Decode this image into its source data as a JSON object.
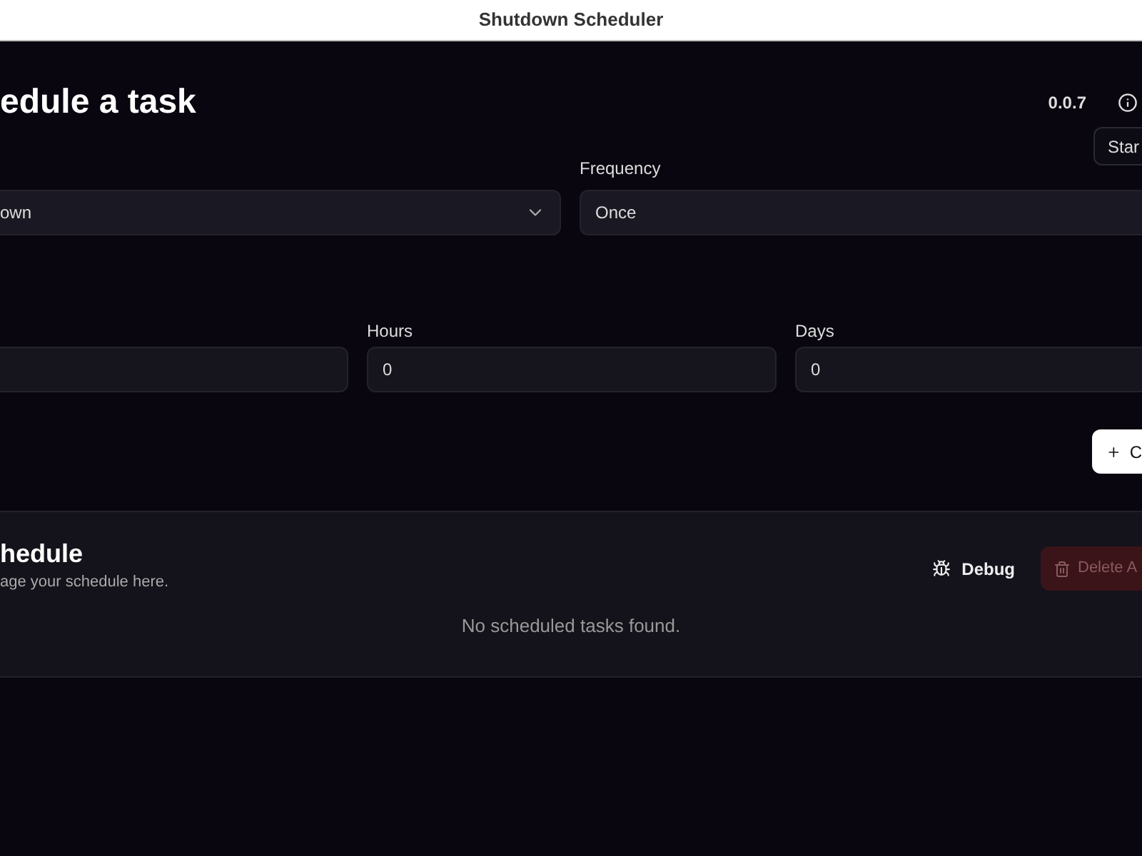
{
  "window": {
    "title": "Shutdown Scheduler"
  },
  "header": {
    "title": "edule a task",
    "version": "0.0.7",
    "start_button": "Star"
  },
  "form": {
    "action": {
      "value": "own"
    },
    "frequency": {
      "label": "Frequency",
      "value": "Once"
    },
    "durations": [
      {
        "kind": "clipped_left"
      },
      {
        "kind": "whole",
        "label": "Hours",
        "value": "0"
      },
      {
        "kind": "clipped_right",
        "label": "Days",
        "value": "0"
      }
    ],
    "add_button": "C"
  },
  "schedule": {
    "title": "hedule",
    "subtitle": "age your schedule here.",
    "debug_button": "Debug",
    "delete_button": {
      "label": "Delete A",
      "disabled": true
    },
    "empty_message": "No scheduled tasks found."
  }
}
